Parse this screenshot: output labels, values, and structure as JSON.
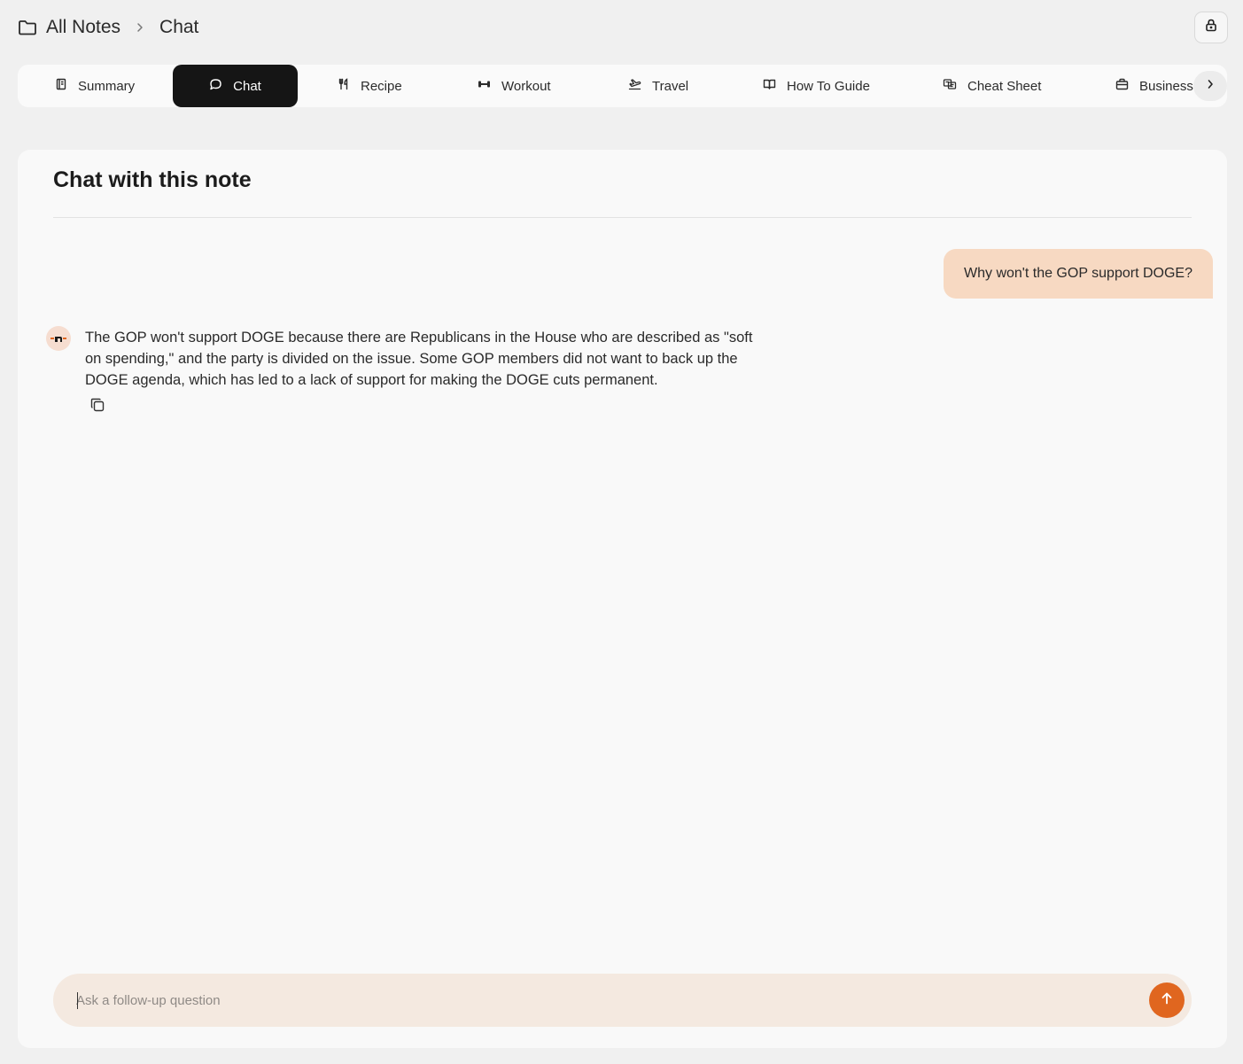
{
  "breadcrumb": {
    "root": "All Notes",
    "current": "Chat"
  },
  "tabs": [
    {
      "label": "Summary",
      "icon": "notebook-icon",
      "active": false
    },
    {
      "label": "Chat",
      "icon": "chat-bubble-icon",
      "active": true
    },
    {
      "label": "Recipe",
      "icon": "utensils-icon",
      "active": false
    },
    {
      "label": "Workout",
      "icon": "dumbbell-icon",
      "active": false
    },
    {
      "label": "Travel",
      "icon": "plane-icon",
      "active": false
    },
    {
      "label": "How To Guide",
      "icon": "book-open-icon",
      "active": false
    },
    {
      "label": "Cheat Sheet",
      "icon": "cheat-sheet-icon",
      "active": false
    },
    {
      "label": "Business",
      "icon": "briefcase-icon",
      "active": false
    }
  ],
  "chat": {
    "title": "Chat with this note",
    "user_message": "Why won't the GOP support DOGE?",
    "assistant_message": "The GOP won't support DOGE because there are Republicans in the House who are described as \"soft on spending,\" and the party is divided on the issue. Some GOP members did not want to back up the DOGE agenda, which has led to a lack of support for making the DOGE cuts permanent.",
    "input_placeholder": "Ask a follow-up question",
    "input_value": ""
  },
  "colors": {
    "accent": "#e0661f",
    "user_bubble": "#f7d9c2",
    "composer_bg": "#f4e9e0",
    "active_tab": "#151515"
  }
}
